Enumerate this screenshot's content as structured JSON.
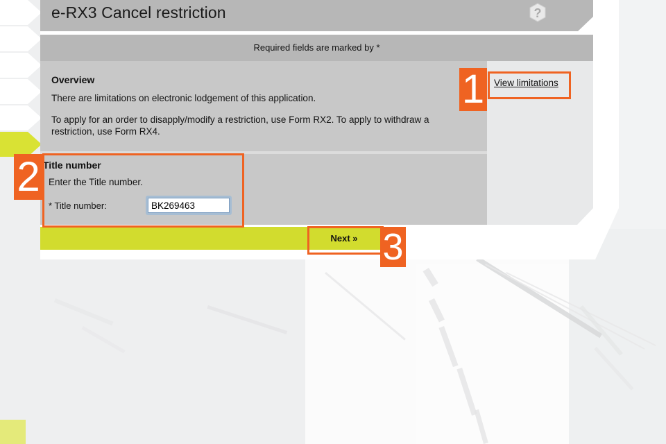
{
  "background": {
    "description": "faded aerial photograph of land parcels"
  },
  "left_nav": {
    "items": [
      {
        "label": "",
        "state": "inactive"
      },
      {
        "label": "",
        "state": "inactive"
      },
      {
        "label": "",
        "state": "inactive"
      },
      {
        "label": "",
        "state": "inactive"
      },
      {
        "label": "",
        "state": "inactive"
      },
      {
        "label": "",
        "state": "current"
      }
    ]
  },
  "header": {
    "title": "e-RX3 Cancel restriction",
    "help_icon": "question-mark-hexagon-icon"
  },
  "required_bar": {
    "text": "Required fields are marked by *"
  },
  "overview": {
    "heading": "Overview",
    "paragraph_1": "There are limitations on electronic lodgement of this application.",
    "paragraph_2": "To apply for an order to disapply/modify a restriction, use Form RX2. To apply to withdraw a restriction, use Form RX4."
  },
  "side_panel": {
    "view_limitations_label": "View limitations"
  },
  "title_number": {
    "heading": "Title number",
    "instruction": "Enter the Title number.",
    "field_label": "* Title number:",
    "field_value": "BK269463",
    "field_placeholder": ""
  },
  "actions": {
    "next_label": "Next »"
  },
  "annotations": [
    {
      "number": "1",
      "target": "view-limitations-link"
    },
    {
      "number": "2",
      "target": "title-number-section"
    },
    {
      "number": "3",
      "target": "next-button"
    }
  ],
  "colors": {
    "accent_orange": "#ef6322",
    "action_yellow": "#d2dc2e",
    "panel_grey": "#c8c8c8",
    "bar_grey": "#b7b7b7",
    "side_panel_grey": "#e8e9ea"
  }
}
